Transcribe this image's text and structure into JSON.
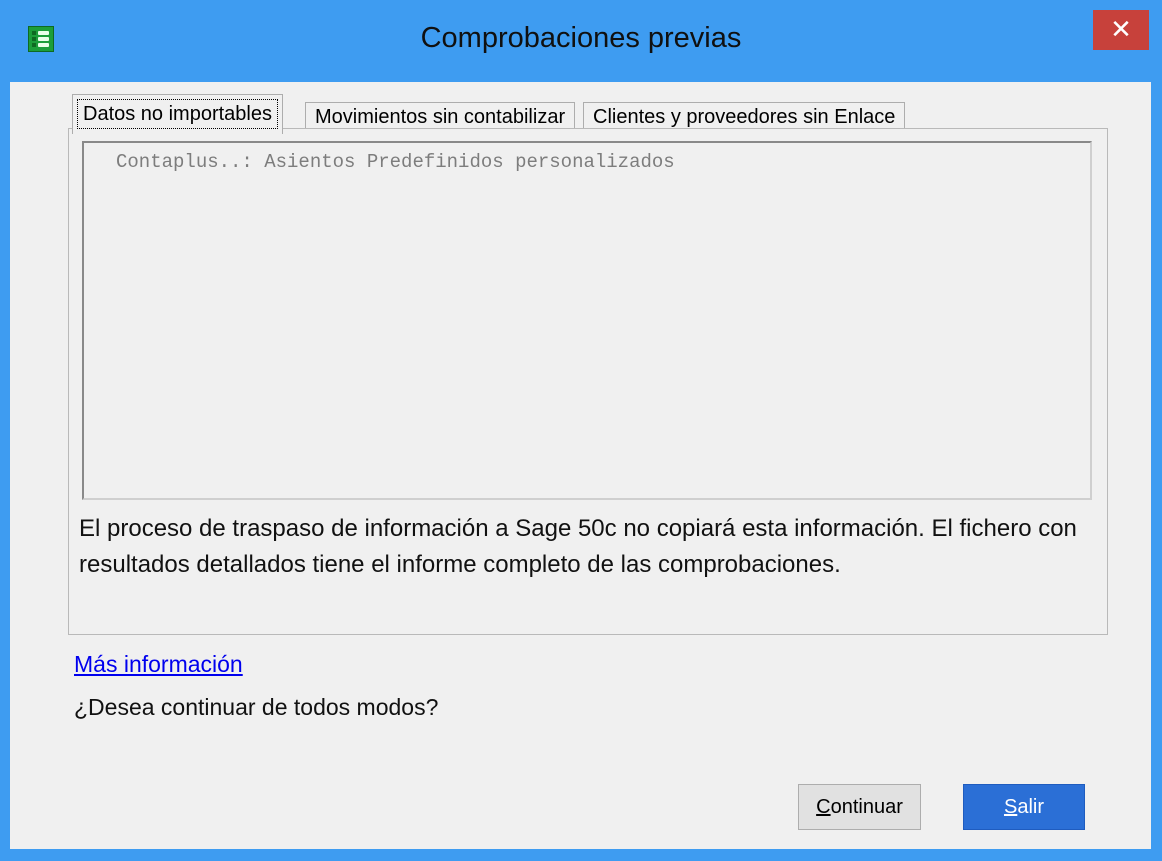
{
  "window": {
    "title": "Comprobaciones previas",
    "close_glyph": "✕",
    "app_icon": "app-table-icon"
  },
  "tabs": [
    {
      "label": "Datos no importables",
      "active": true
    },
    {
      "label": "Movimientos sin contabilizar",
      "active": false
    },
    {
      "label": "Clientes y proveedores sin Enlace",
      "active": false
    }
  ],
  "list": {
    "items": [
      "Contaplus..: Asientos Predefinidos personalizados"
    ]
  },
  "info_text": "El proceso de traspaso de información a Sage 50c no copiará esta información. El fichero con resultados detallados tiene el informe completo de las comprobaciones.",
  "more_info_link": "Más información",
  "question": "¿Desea continuar de todos modos?",
  "buttons": {
    "continue_mnemonic": "C",
    "continue_rest": "ontinuar",
    "exit_mnemonic": "S",
    "exit_rest": "alir"
  },
  "colors": {
    "title_bar": "#3e9cf1",
    "close_button": "#c7413b",
    "primary_button": "#2b6fd6",
    "link": "#0000ee"
  }
}
